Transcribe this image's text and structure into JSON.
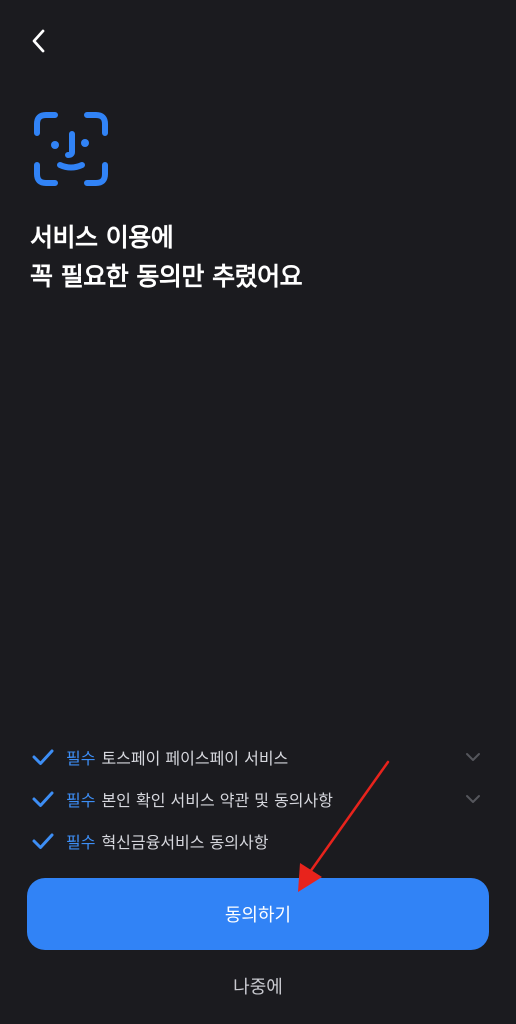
{
  "header": {
    "back_icon": "chevron-left-icon"
  },
  "hero": {
    "icon": "face-id-icon",
    "accent_color": "#3183f6"
  },
  "title": {
    "line1": "서비스 이용에",
    "line2": "꼭 필요한 동의만 추렸어요"
  },
  "terms": [
    {
      "required": "필수",
      "label": "토스페이 페이스페이 서비스",
      "expandable": true,
      "checked": true
    },
    {
      "required": "필수",
      "label": "본인 확인 서비스 약관 및 동의사항",
      "expandable": true,
      "checked": true
    },
    {
      "required": "필수",
      "label": "혁신금융서비스 동의사항",
      "expandable": false,
      "checked": true
    }
  ],
  "actions": {
    "agree_label": "동의하기",
    "later_label": "나중에"
  },
  "annotation": {
    "icon": "red-arrow-icon",
    "color": "#e8231c"
  }
}
